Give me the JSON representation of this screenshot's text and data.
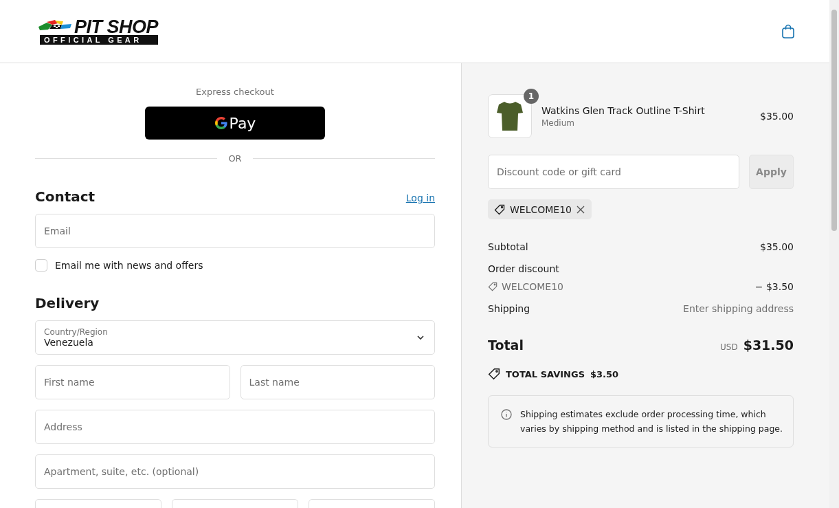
{
  "header": {
    "logo": {
      "title": "PIT SHOP",
      "subtitle": "OFFICIAL GEAR"
    }
  },
  "express": {
    "title": "Express checkout",
    "gpay_label": "Pay",
    "divider": "OR"
  },
  "contact": {
    "heading": "Contact",
    "login_link": "Log in",
    "email_placeholder": "Email",
    "newsletter": {
      "label": "Email me with news and offers",
      "checked": false
    }
  },
  "delivery": {
    "heading": "Delivery",
    "country": {
      "label": "Country/Region",
      "value": "Venezuela"
    },
    "name_row": [
      {
        "placeholder": "First name"
      },
      {
        "placeholder": "Last name"
      }
    ],
    "address_fields": [
      {
        "placeholder": "Address"
      },
      {
        "placeholder": "Apartment, suite, etc. (optional)"
      }
    ]
  },
  "summary": {
    "item": {
      "name": "Watkins Glen Track Outline T-Shirt",
      "variant": "Medium",
      "price": "$35.00",
      "quantity": "1"
    },
    "discount": {
      "placeholder": "Discount code or gift card",
      "apply": "Apply",
      "applied_code": "WELCOME10"
    },
    "lines": [
      {
        "kind": "plain",
        "label": "Subtotal",
        "value": "$35.00"
      },
      {
        "kind": "heading",
        "label": "Order discount"
      },
      {
        "kind": "code",
        "label": "WELCOME10",
        "value": "− $3.50"
      },
      {
        "kind": "muted",
        "label": "Shipping",
        "value": "Enter shipping address"
      }
    ],
    "total": {
      "label": "Total",
      "currency": "USD",
      "amount": "$31.50"
    },
    "savings": {
      "label": "TOTAL SAVINGS",
      "amount": "$3.50"
    },
    "note": "Shipping estimates exclude order processing time, which varies by shipping method and is listed in the shipping page."
  }
}
